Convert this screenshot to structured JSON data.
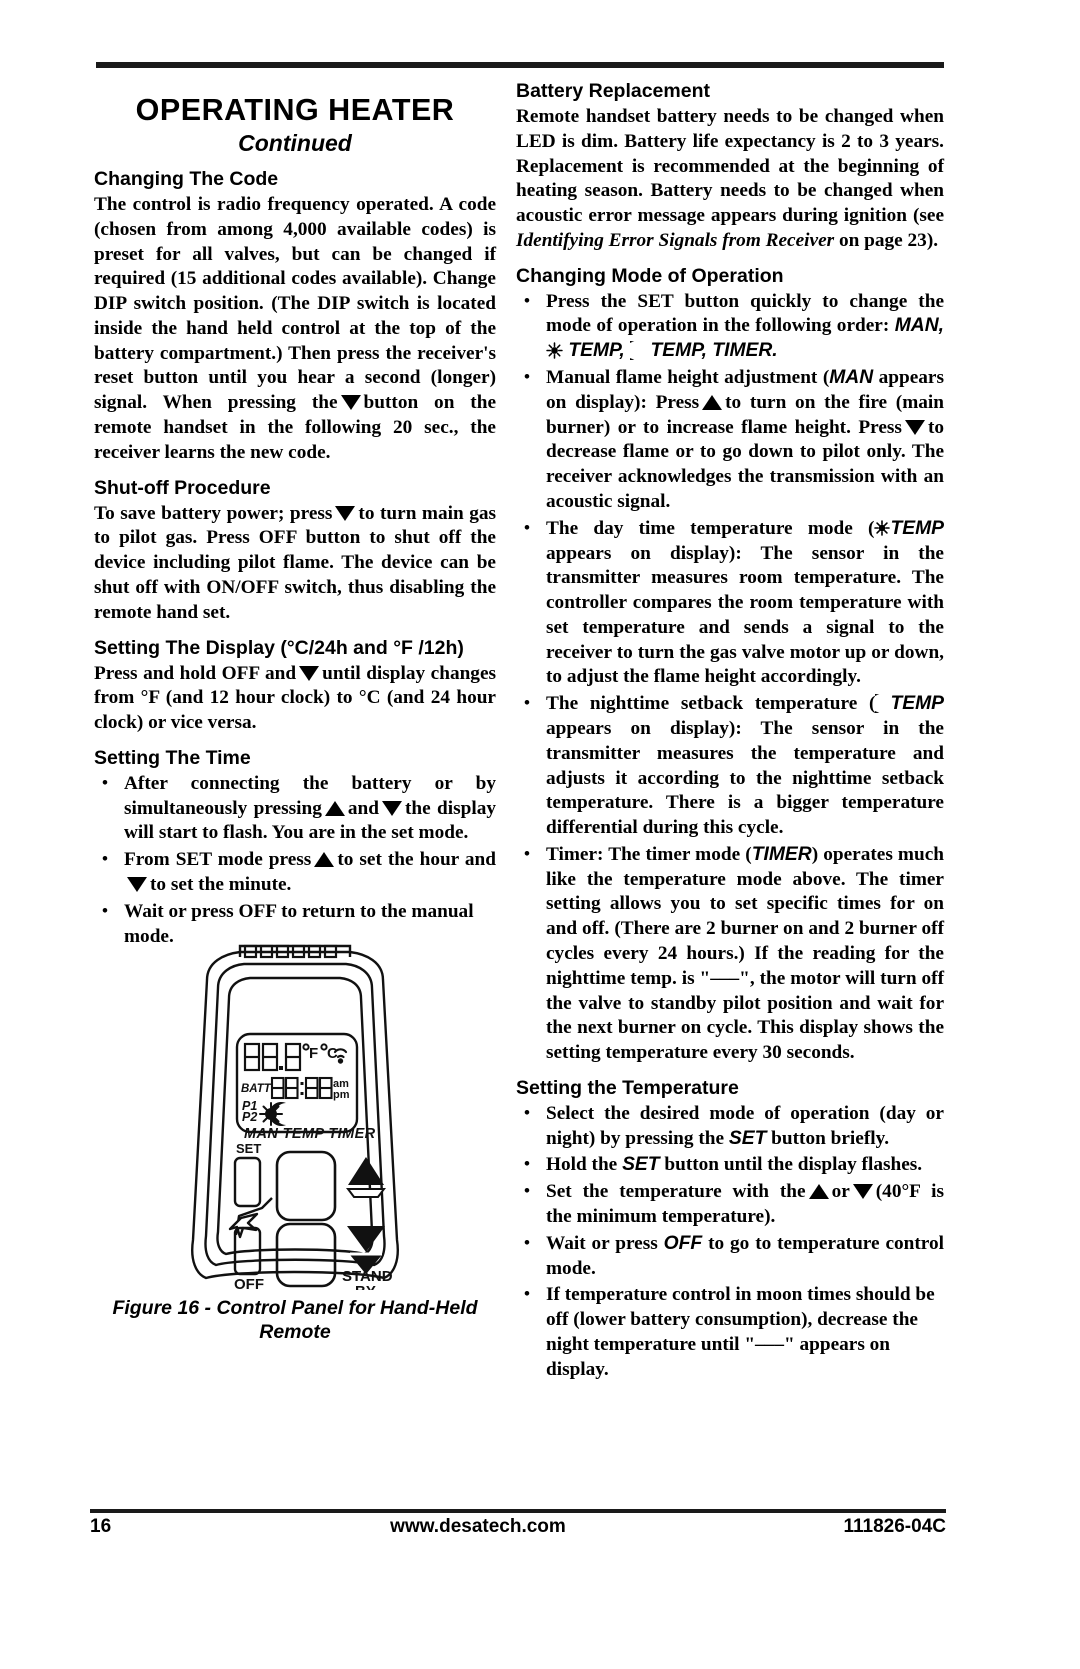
{
  "page": {
    "title": "OPERATING HEATER",
    "subtitle": "Continued"
  },
  "left_column": {
    "sections": [
      {
        "heading": "Changing The Code",
        "paragraph_parts": {
          "p1_a": "The control is radio frequency operated. A code (chosen from among 4,000 available codes) is preset for all valves, but can be changed if required (15 additional codes available). Change DIP switch position. (The DIP switch is located inside the hand held  control at the top of the battery compartment.) Then press the receiver's reset button until you hear a second (longer) signal. When pressing the",
          "p1_b": "button on the remote handset in the following 20 sec., the receiver learns the new code."
        }
      },
      {
        "heading": "Shut-off Procedure",
        "paragraph_parts": {
          "p1_a": "To save battery power; press",
          "p1_b": "to turn main gas to pilot gas. Press OFF button to  shut off the device including pilot flame. The device can be shut off with ON/OFF switch, thus disabling the remote hand set."
        }
      },
      {
        "heading": "Setting The Display (°C/24h and °F /12h)",
        "paragraph_parts": {
          "p1_a": "Press and hold OFF and",
          "p1_b": "until display changes from °F (and 12 hour clock) to °C (and 24 hour clock) or vice versa."
        }
      },
      {
        "heading": "Setting The Time",
        "bullets": [
          {
            "a": "After connecting the battery or by simultaneously pressing",
            "b": "and",
            "c": "the display will start to flash.  You are in the set mode."
          },
          {
            "a": "From SET mode press",
            "b": "to set the hour and",
            "c": "to set the minute."
          },
          {
            "a": "Wait or press OFF to return to the manual mode."
          }
        ]
      }
    ]
  },
  "figure": {
    "caption_line1": "Figure 16 - Control Panel for Hand-Held",
    "caption_line2": "Remote",
    "lcd": {
      "temp_digits": "88.8",
      "unit_f": "°F",
      "unit_c": "°C",
      "signal_icon": "signal-waves-icon",
      "batt_label": "BATT",
      "clock_digits": "88:88",
      "am_label": "am",
      "pm_label": "pm",
      "p1_label": "P1",
      "p2_label": "P2",
      "sun_icon": "sun-icon",
      "moon_icon": "moon-icon",
      "mode_labels": "MAN TEMP TIMER"
    },
    "buttons": {
      "set_label": "SET",
      "off_label": "OFF",
      "stand_label": "STAND",
      "by_label": "BY",
      "flame_icon": "flame-spark-icon",
      "up_icon": "triangle-up-icon",
      "down_icon": "triangle-down-icon"
    }
  },
  "right_column": {
    "sections": [
      {
        "heading": "Battery Replacement",
        "paragraph_parts": {
          "a": "Remote handset battery needs to be changed when LED is dim. Battery life expectancy is 2 to 3 years. Replacement is recommended at the beginning of heating season. Battery needs to be changed when acoustic error message appears during ignition (see ",
          "italic": "Identifying Error Signals from Receiver",
          "b": " on page 23)."
        }
      },
      {
        "heading": "Changing Mode of Operation",
        "bullets": [
          {
            "a": "Press the SET button quickly to change the mode of operation in the following order:",
            "modes_1": "MAN,",
            "modes_2": "TEMP,",
            "modes_3": "TEMP, TIMER."
          },
          {
            "a": "Manual flame height adjustment (",
            "man": "MAN",
            "b": " appears on display): Press",
            "c": "to turn on the fire (main burner) or to increase flame height. Press",
            "d": "to decrease flame or to go down to pilot only. The receiver acknowledges the transmission with an acoustic signal."
          },
          {
            "a": "The day time temperature mode (",
            "temp": "TEMP",
            "b": " appears on display): The sensor in the transmitter measures room temperature. The controller compares the room temperature with set temperature and sends a signal to the receiver to turn the gas valve motor up or down, to adjust the flame height accordingly."
          },
          {
            "a": "The nighttime setback temperature (",
            "temp": "TEMP",
            "b": " appears on display): The sensor in the transmitter measures the temperature and adjusts it according to the nighttime setback temperature. There is a bigger temperature differential during this cycle."
          },
          {
            "a": "Timer: The timer mode (",
            "timer": "TIMER",
            "b": ") operates much like the temperature mode above. The timer setting allows you to set specific times for on and off. (There are 2 burner on and 2 burner off cycles every 24 hours.) If the reading for the nighttime temp. is \"–––\", the motor will turn off the valve to standby pilot position and wait for the next burner on cycle. This display shows the setting temperature every 30 seconds."
          }
        ]
      },
      {
        "heading": "Setting the Temperature",
        "bullets": [
          {
            "a": "Select the desired mode of operation (day or night) by pressing the ",
            "set": "SET",
            "b": " button briefly."
          },
          {
            "a": "Hold the ",
            "set": "SET",
            "b": " button until the display flashes."
          },
          {
            "a": "Set the temperature with the",
            "b": "or",
            "c": "(40°F is the minimum temperature)."
          },
          {
            "a": "Wait or press ",
            "off": "OFF",
            "b": " to go to temperature control mode."
          },
          {
            "a": "If temperature control in moon times should be off (lower battery consumption), decrease the night temperature until \"–––\" appears on display."
          }
        ]
      }
    ]
  },
  "footer": {
    "page_number": "16",
    "website": "www.desatech.com",
    "document_id": "111826-04C"
  }
}
